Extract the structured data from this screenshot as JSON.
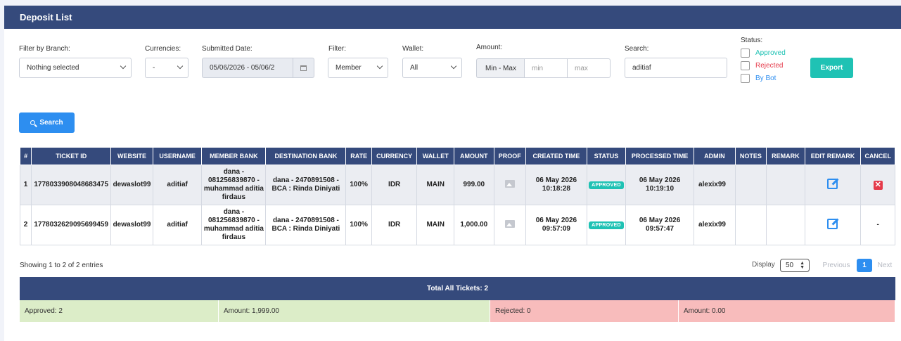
{
  "header": {
    "title": "Deposit List"
  },
  "filters": {
    "branch": {
      "label": "Filter by Branch:",
      "value": "Nothing selected"
    },
    "currencies": {
      "label": "Currencies:",
      "value": "-"
    },
    "submitted": {
      "label": "Submitted Date:",
      "value": "05/06/2026 - 05/06/2"
    },
    "filter": {
      "label": "Filter:",
      "value": "Member"
    },
    "wallet": {
      "label": "Wallet:",
      "value": "All"
    },
    "amount": {
      "label": "Amount:",
      "addon": "Min - Max",
      "min_placeholder": "min",
      "max_placeholder": "max"
    },
    "search": {
      "label": "Search:",
      "value": "aditiaf"
    },
    "status": {
      "label": "Status:",
      "approved": "Approved",
      "rejected": "Rejected",
      "bybot": "By Bot"
    },
    "export_label": "Export",
    "search_button": "Search"
  },
  "colors": {
    "approved": "#1fc2b4",
    "rejected": "#e53a4a",
    "bybot": "#2d8ef0",
    "header": "#354a7c"
  },
  "table": {
    "headers": [
      "#",
      "TICKET ID",
      "WEBSITE",
      "USERNAME",
      "MEMBER BANK",
      "DESTINATION BANK",
      "RATE",
      "CURRENCY",
      "WALLET",
      "AMOUNT",
      "PROOF",
      "CREATED TIME",
      "STATUS",
      "PROCESSED TIME",
      "ADMIN",
      "NOTES",
      "REMARK",
      "EDIT REMARK",
      "CANCEL"
    ],
    "rows": [
      {
        "no": "1",
        "ticket": "1778033908048683475",
        "website": "dewaslot99",
        "username": "aditiaf",
        "member_bank": "dana - 081256839870 - muhammad aditia firdaus",
        "dest_bank": "dana - 2470891508 - BCA : Rinda Diniyati",
        "rate": "100%",
        "currency": "IDR",
        "wallet": "MAIN",
        "amount": "999.00",
        "created_date": "06 May 2026",
        "created_time": "10:18:28",
        "status": "APPROVED",
        "processed_date": "06 May 2026",
        "processed_time": "10:19:10",
        "admin": "alexix99",
        "cancel": ""
      },
      {
        "no": "2",
        "ticket": "1778032629095699459",
        "website": "dewaslot99",
        "username": "aditiaf",
        "member_bank": "dana - 081256839870 - muhammad aditia firdaus",
        "dest_bank": "dana - 2470891508 - BCA : Rinda Diniyati",
        "rate": "100%",
        "currency": "IDR",
        "wallet": "MAIN",
        "amount": "1,000.00",
        "created_date": "06 May 2026",
        "created_time": "09:57:09",
        "status": "APPROVED",
        "processed_date": "06 May 2026",
        "processed_time": "09:57:47",
        "admin": "alexix99",
        "cancel": "-"
      }
    ]
  },
  "footer": {
    "showing": "Showing 1 to 2 of 2 entries",
    "display_label": "Display",
    "display_value": "50",
    "prev": "Previous",
    "page": "1",
    "next": "Next"
  },
  "summary": {
    "title": "Total All Tickets: 2",
    "approved": "Approved: 2",
    "approved_amount": "Amount: 1,999.00",
    "rejected": "Rejected: 0",
    "rejected_amount": "Amount: 0.00"
  }
}
